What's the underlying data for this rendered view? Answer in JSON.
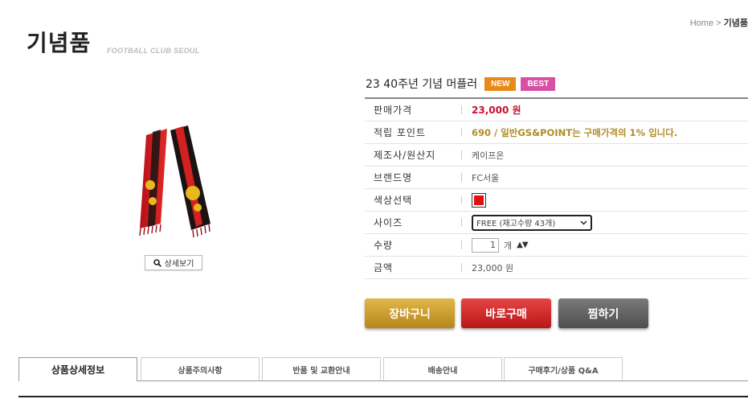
{
  "breadcrumb": {
    "home": "Home",
    "separator": ">",
    "current": "기념품"
  },
  "page": {
    "title": "기념품",
    "subtitle": "FOOTBALL CLUB SEOUL"
  },
  "product": {
    "name": "23 40주년 기념 머플러",
    "badges": {
      "new": "NEW",
      "best": "BEST"
    },
    "image_icon": "scarf-image",
    "zoom_label": "상세보기"
  },
  "info": {
    "price": {
      "label": "판매가격",
      "value": "23,000 원"
    },
    "points": {
      "label": "적립 포인트",
      "value": "690 / 일반GS&POINT는 구매가격의 1% 입니다."
    },
    "maker": {
      "label": "제조사/원산지",
      "value": "케이프온"
    },
    "brand": {
      "label": "브랜드명",
      "value": "FC서울"
    },
    "color": {
      "label": "색상선택",
      "swatch": "#e01010"
    },
    "size": {
      "label": "사이즈",
      "selected": "FREE (재고수량 43개)"
    },
    "quantity": {
      "label": "수량",
      "value": "1",
      "unit": "개",
      "arrows": "▲▼"
    },
    "total": {
      "label": "금액",
      "value": "23,000 원"
    }
  },
  "actions": {
    "cart": "장바구니",
    "buy": "바로구매",
    "wish": "찜하기"
  },
  "tabs": [
    {
      "label": "상품상세정보"
    },
    {
      "label": "상품주의사항"
    },
    {
      "label": "반품 및 교환안내"
    },
    {
      "label": "배송안내"
    },
    {
      "label": "구매후기/상품 Q&A"
    }
  ],
  "colors": {
    "price": "#c8102e",
    "points": "#b08d28",
    "new_badge": "#e8891a",
    "best_badge": "#d94fa6",
    "cart": "#c99a2c",
    "buy": "#d02a2a",
    "wish": "#5e5e5e"
  }
}
